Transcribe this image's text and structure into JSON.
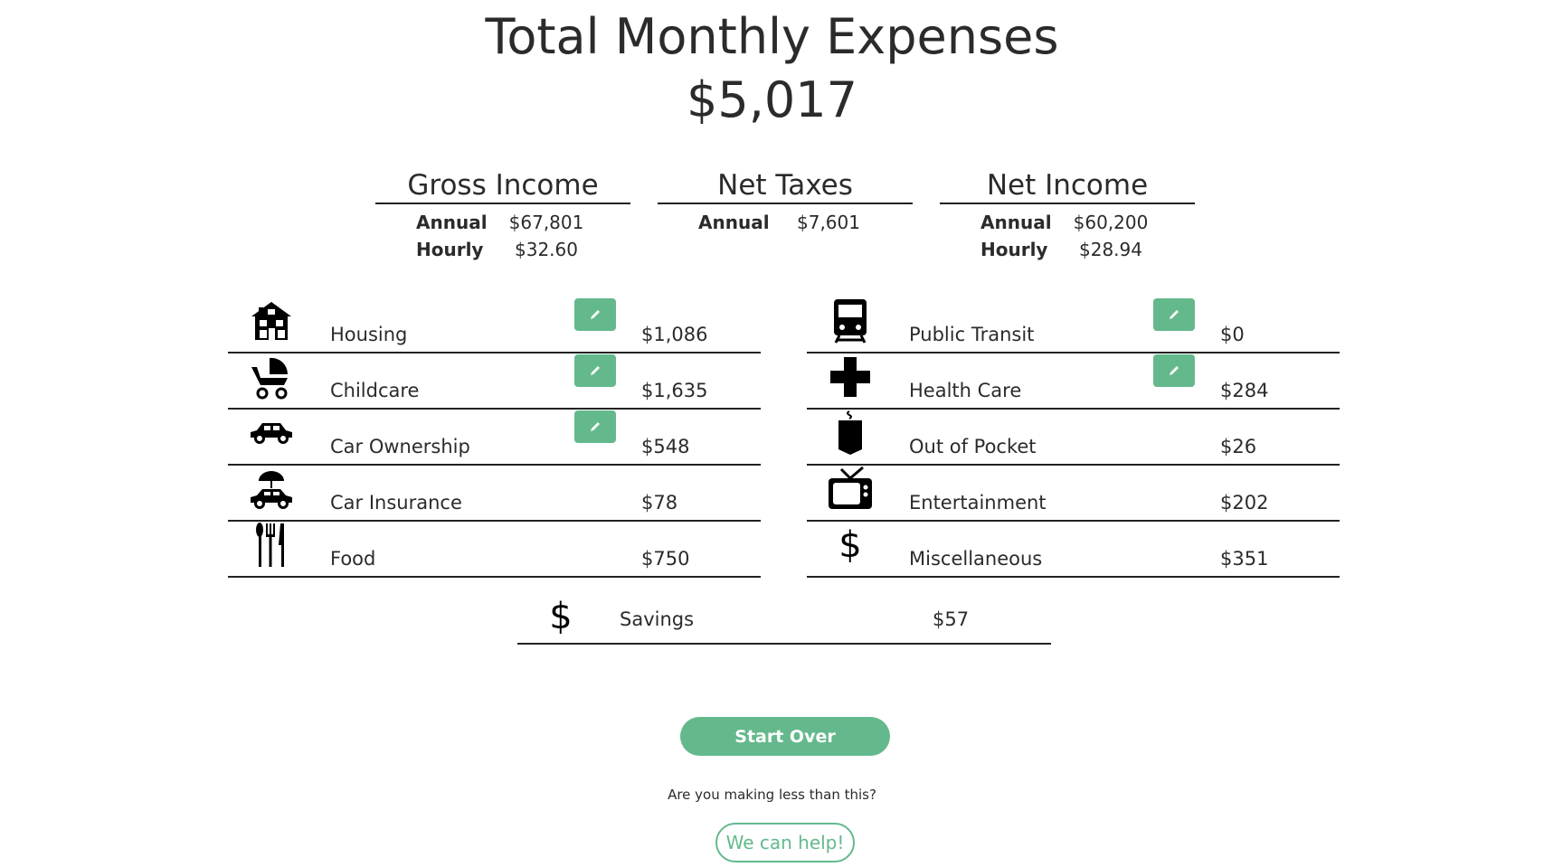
{
  "header": {
    "title": "Total Monthly Expenses",
    "total": "$5,017"
  },
  "summary": [
    {
      "title": "Gross Income",
      "rows": [
        {
          "label": "Annual",
          "value": "$67,801"
        },
        {
          "label": "Hourly",
          "value": "$32.60"
        }
      ]
    },
    {
      "title": "Net Taxes",
      "rows": [
        {
          "label": "Annual",
          "value": "$7,601"
        }
      ]
    },
    {
      "title": "Net Income",
      "rows": [
        {
          "label": "Annual",
          "value": "$60,200"
        },
        {
          "label": "Hourly",
          "value": "$28.94"
        }
      ]
    }
  ],
  "expenses_left": [
    {
      "label": "Housing",
      "value": "$1,086",
      "icon": "house-icon",
      "editable": true
    },
    {
      "label": "Childcare",
      "value": "$1,635",
      "icon": "stroller-icon",
      "editable": true
    },
    {
      "label": "Car Ownership",
      "value": "$548",
      "icon": "car-icon",
      "editable": true
    },
    {
      "label": "Car Insurance",
      "value": "$78",
      "icon": "car-umbrella-icon",
      "editable": false
    },
    {
      "label": "Food",
      "value": "$750",
      "icon": "utensils-icon",
      "editable": false
    }
  ],
  "expenses_right": [
    {
      "label": "Public Transit",
      "value": "$0",
      "icon": "train-icon",
      "editable": true
    },
    {
      "label": "Health Care",
      "value": "$284",
      "icon": "medical-cross-icon",
      "editable": true
    },
    {
      "label": "Out of Pocket",
      "value": "$26",
      "icon": "pocket-icon",
      "editable": false
    },
    {
      "label": "Entertainment",
      "value": "$202",
      "icon": "tv-icon",
      "editable": false
    },
    {
      "label": "Miscellaneous",
      "value": "$351",
      "icon": "dollar-icon",
      "editable": false
    }
  ],
  "savings": {
    "label": "Savings",
    "value": "$57",
    "icon": "dollar-icon"
  },
  "icons": {
    "dollar": "$"
  },
  "actions": {
    "start_over": "Start Over",
    "question": "Are you making less than this?",
    "help": "We can help!"
  },
  "colors": {
    "accent": "#64b98c",
    "text": "#2b2b2b"
  }
}
